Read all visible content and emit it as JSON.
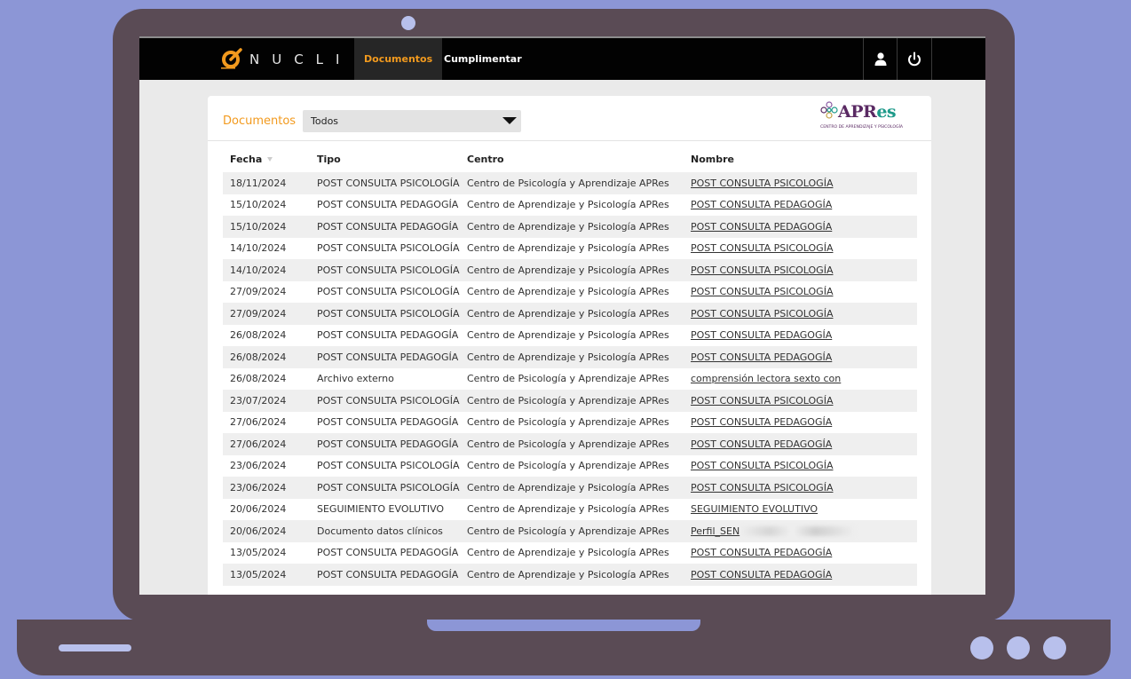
{
  "app": {
    "logo_text": "NUCLI",
    "tabs": [
      {
        "label": "Documentos",
        "active": true
      },
      {
        "label": "Cumplimentar",
        "active": false
      }
    ],
    "accent_color": "#f29a1e"
  },
  "card": {
    "section_label": "Documentos",
    "filter": {
      "selected": "Todos"
    },
    "brand": {
      "name_main": "APR",
      "name_accent": "es",
      "tagline": "CENTRO DE APRENDIZAJE Y PSICOLOGÍA"
    }
  },
  "table": {
    "headers": {
      "fecha": "Fecha",
      "tipo": "Tipo",
      "centro": "Centro",
      "nombre": "Nombre"
    },
    "rows": [
      {
        "fecha": "18/11/2024",
        "tipo": "POST CONSULTA PSICOLOGÍA",
        "centro": "Centro de Psicología y Aprendizaje APRes",
        "nombre": "POST CONSULTA PSICOLOGÍA"
      },
      {
        "fecha": "15/10/2024",
        "tipo": "POST CONSULTA PEDAGOGÍA",
        "centro": "Centro de Aprendizaje y Psicología APRes",
        "nombre": "POST CONSULTA PEDAGOGÍA"
      },
      {
        "fecha": "15/10/2024",
        "tipo": "POST CONSULTA PEDAGOGÍA",
        "centro": "Centro de Aprendizaje y Psicología APRes",
        "nombre": "POST CONSULTA PEDAGOGÍA"
      },
      {
        "fecha": "14/10/2024",
        "tipo": "POST CONSULTA PSICOLOGÍA",
        "centro": "Centro de Aprendizaje y Psicología APRes",
        "nombre": "POST CONSULTA PSICOLOGÍA"
      },
      {
        "fecha": "14/10/2024",
        "tipo": "POST CONSULTA PSICOLOGÍA",
        "centro": "Centro de Aprendizaje y Psicología APRes",
        "nombre": "POST CONSULTA PSICOLOGÍA"
      },
      {
        "fecha": "27/09/2024",
        "tipo": "POST CONSULTA PSICOLOGÍA",
        "centro": "Centro de Aprendizaje y Psicología APRes",
        "nombre": "POST CONSULTA PSICOLOGÍA"
      },
      {
        "fecha": "27/09/2024",
        "tipo": "POST CONSULTA PSICOLOGÍA",
        "centro": "Centro de Aprendizaje y Psicología APRes",
        "nombre": "POST CONSULTA PSICOLOGÍA"
      },
      {
        "fecha": "26/08/2024",
        "tipo": "POST CONSULTA PEDAGOGÍA",
        "centro": "Centro de Aprendizaje y Psicología APRes",
        "nombre": "POST CONSULTA PEDAGOGÍA"
      },
      {
        "fecha": "26/08/2024",
        "tipo": "POST CONSULTA PEDAGOGÍA",
        "centro": "Centro de Aprendizaje y Psicología APRes",
        "nombre": "POST CONSULTA PEDAGOGÍA"
      },
      {
        "fecha": "26/08/2024",
        "tipo": "Archivo externo",
        "centro": "Centro de Psicología y Aprendizaje APRes",
        "nombre": "comprensión lectora sexto con"
      },
      {
        "fecha": "23/07/2024",
        "tipo": "POST CONSULTA PSICOLOGÍA",
        "centro": "Centro de Psicología y Aprendizaje APRes",
        "nombre": "POST CONSULTA PSICOLOGÍA"
      },
      {
        "fecha": "27/06/2024",
        "tipo": "POST CONSULTA PEDAGOGÍA",
        "centro": "Centro de Psicología y Aprendizaje APRes",
        "nombre": "POST CONSULTA PEDAGOGÍA"
      },
      {
        "fecha": "27/06/2024",
        "tipo": "POST CONSULTA PEDAGOGÍA",
        "centro": "Centro de Psicología y Aprendizaje APRes",
        "nombre": "POST CONSULTA PEDAGOGÍA"
      },
      {
        "fecha": "23/06/2024",
        "tipo": "POST CONSULTA PSICOLOGÍA",
        "centro": "Centro de Psicología y Aprendizaje APRes",
        "nombre": "POST CONSULTA PSICOLOGÍA"
      },
      {
        "fecha": "23/06/2024",
        "tipo": "POST CONSULTA PSICOLOGÍA",
        "centro": "Centro de Aprendizaje y Psicología APRes",
        "nombre": "POST CONSULTA PSICOLOGÍA"
      },
      {
        "fecha": "20/06/2024",
        "tipo": "SEGUIMIENTO EVOLUTIVO",
        "centro": "Centro de Aprendizaje y Psicología APRes",
        "nombre": "SEGUIMIENTO EVOLUTIVO"
      },
      {
        "fecha": "20/06/2024",
        "tipo": "Documento datos clínicos",
        "centro": "Centro de Psicología y Aprendizaje APRes",
        "nombre": "Perfil_SEN",
        "redacted": true
      },
      {
        "fecha": "13/05/2024",
        "tipo": "POST CONSULTA PEDAGOGÍA",
        "centro": "Centro de Aprendizaje y Psicología APRes",
        "nombre": "POST CONSULTA PEDAGOGÍA"
      },
      {
        "fecha": "13/05/2024",
        "tipo": "POST CONSULTA PEDAGOGÍA",
        "centro": "Centro de Aprendizaje y Psicología APRes",
        "nombre": "POST CONSULTA PEDAGOGÍA"
      }
    ]
  }
}
